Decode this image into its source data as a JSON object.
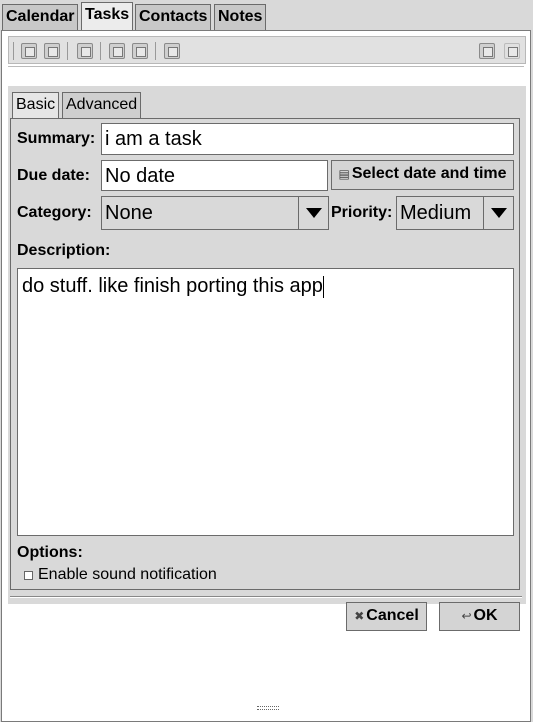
{
  "app_tabs": [
    "Calendar",
    "Tasks",
    "Contacts",
    "Notes"
  ],
  "active_app_tab": "Tasks",
  "toolbar_icons": [
    "new-task-icon",
    "edit-task-icon",
    "delete-task-icon",
    "undo-icon",
    "redo-icon",
    "export-icon",
    "view-toggle-icon",
    "network-icon"
  ],
  "inner_tabs": [
    "Basic",
    "Advanced"
  ],
  "form": {
    "summary_label": "Summary:",
    "summary_value": "i am a task",
    "due_label": "Due date:",
    "due_value": "No date",
    "select_date_button": "Select date and time",
    "category_label": "Category:",
    "category_value": "None",
    "priority_label": "Priority:",
    "priority_value": "Medium",
    "description_label": "Description:",
    "description_value": "do stuff. like finish porting this app",
    "options_label": "Options:",
    "sound_label": "Enable sound notification"
  },
  "buttons": {
    "cancel": "Cancel",
    "ok": "OK"
  },
  "colors": {
    "background": "#d9d9d9",
    "field": "#ffffff",
    "border": "#6b6b6b"
  }
}
